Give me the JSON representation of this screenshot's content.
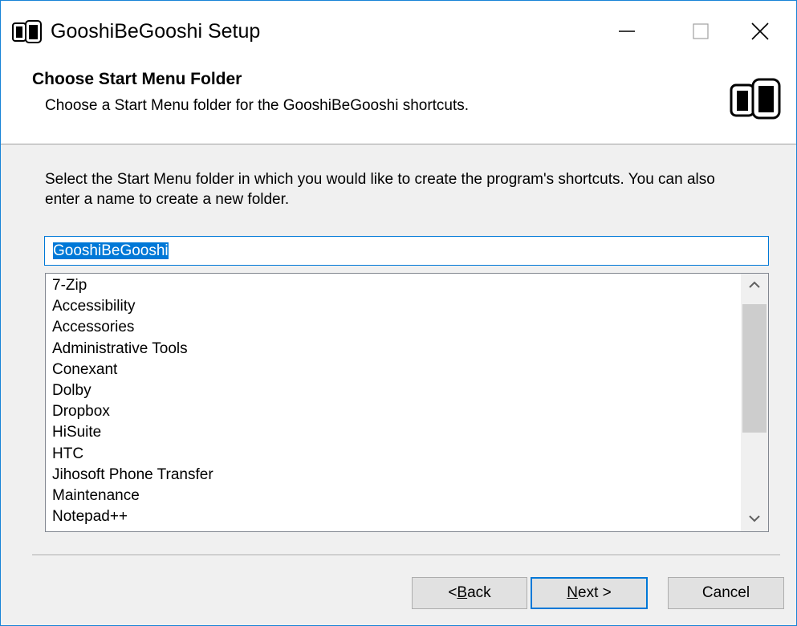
{
  "window": {
    "title": "GooshiBeGooshi Setup",
    "icons": {
      "app": "installer-app-icon",
      "minimize": "minimize-icon",
      "maximize": "maximize-icon",
      "close": "close-icon"
    }
  },
  "header": {
    "title": "Choose Start Menu Folder",
    "subtitle": "Choose a Start Menu folder for the GooshiBeGooshi shortcuts.",
    "icon": "installer-logo-icon"
  },
  "body": {
    "instruction": "Select the Start Menu folder in which you would like to create the program's shortcuts. You can also enter a name to create a new folder.",
    "folder_input": {
      "value": "GooshiBeGooshi",
      "selected": true
    },
    "folder_list": [
      "7-Zip",
      "Accessibility",
      "Accessories",
      "Administrative Tools",
      "Conexant",
      "Dolby",
      "Dropbox",
      "HiSuite",
      "HTC",
      "Jihosoft Phone Transfer",
      "Maintenance",
      "Notepad++"
    ],
    "scrollbar_icons": {
      "up": "chevron-up-icon",
      "down": "chevron-down-icon"
    }
  },
  "buttons": {
    "back": {
      "accel": "B",
      "rest": "ack",
      "prefix": "< "
    },
    "next": {
      "accel": "N",
      "rest": "ext >"
    },
    "cancel": {
      "label": "Cancel"
    }
  },
  "colors": {
    "accent": "#0078d7",
    "window_border": "#1883d7",
    "dialog_bg": "#f0f0f0",
    "button_bg": "#e1e1e1"
  }
}
